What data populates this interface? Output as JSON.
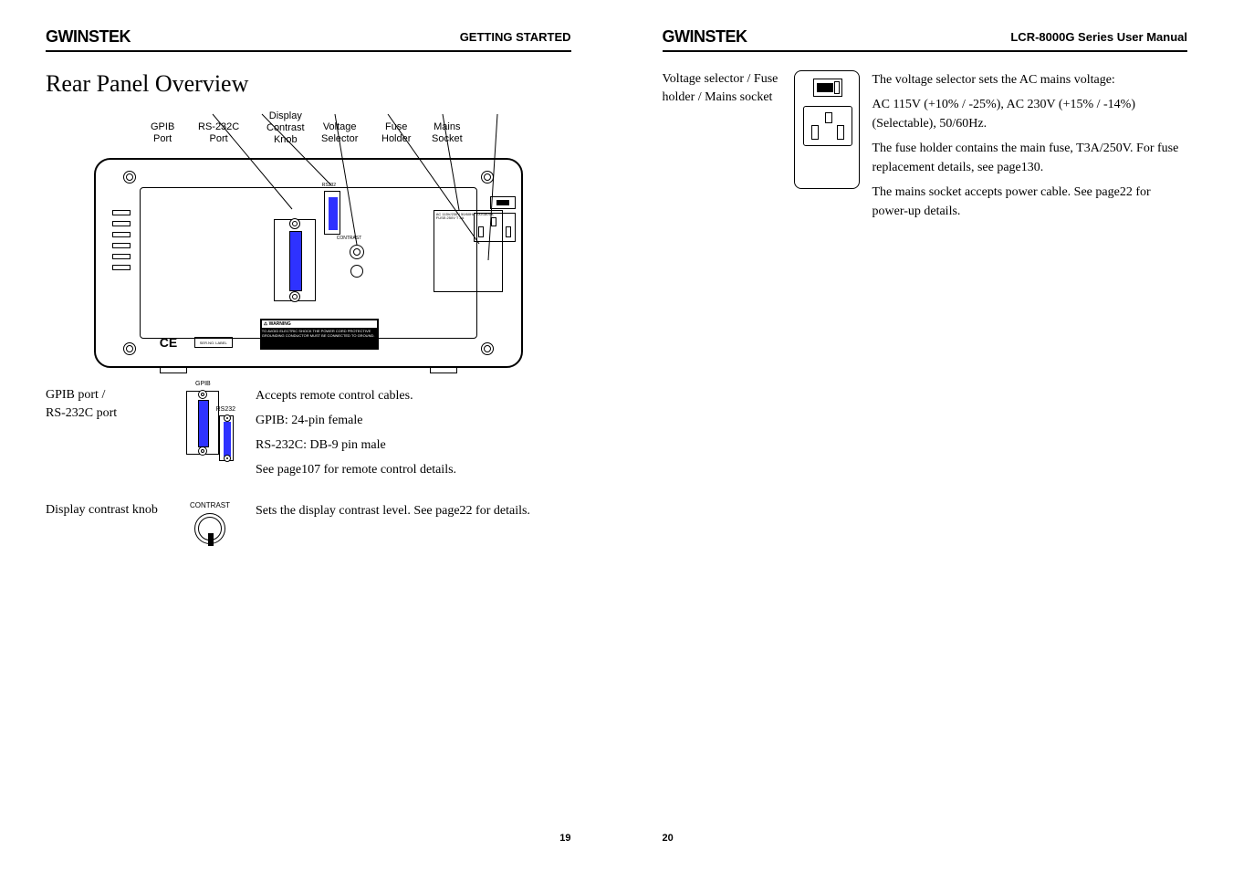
{
  "brand": "GWINSTEK",
  "left_page": {
    "header_right": "GETTING STARTED",
    "section_title": "Rear Panel Overview",
    "page_number": "19",
    "diagram_labels": {
      "gpib": "GPIB\nPort",
      "rs232": "RS-232C\nPort",
      "contrast": "Display\nContrast\nKnob",
      "voltage": "Voltage\nSelector",
      "fuse": "Fuse\nHolder",
      "mains": "Mains\nSocket"
    },
    "rows": [
      {
        "label": "GPIB port /\nRS-232C port",
        "lines": [
          "Accepts remote control cables.",
          "GPIB: 24-pin female",
          "RS-232C: DB-9 pin male",
          "See page107 for remote control details."
        ],
        "icon_labels": {
          "gpib": "GPIB",
          "rs232": "RS232"
        }
      },
      {
        "label": "Display contrast knob",
        "lines": [
          "Sets the display contrast level. See page22 for details."
        ],
        "icon_label": "CONTRAST"
      }
    ]
  },
  "right_page": {
    "header_right": "LCR-8000G Series User Manual",
    "page_number": "20",
    "rows": [
      {
        "label": "Voltage selector / Fuse holder / Mains socket",
        "lines": [
          "The voltage selector sets the AC mains voltage:",
          "AC 115V (+10% / -25%), AC 230V (+15% / -14%) (Selectable), 50/60Hz.",
          "The fuse holder contains the main fuse, T3A/250V. For fuse replacement details, see page130.",
          "The mains socket accepts power cable. See page22 for power-up details."
        ]
      }
    ]
  },
  "internal_text": {
    "ce": "CE",
    "warning": "WARNING",
    "serial": "SER.NO. LABEL"
  }
}
